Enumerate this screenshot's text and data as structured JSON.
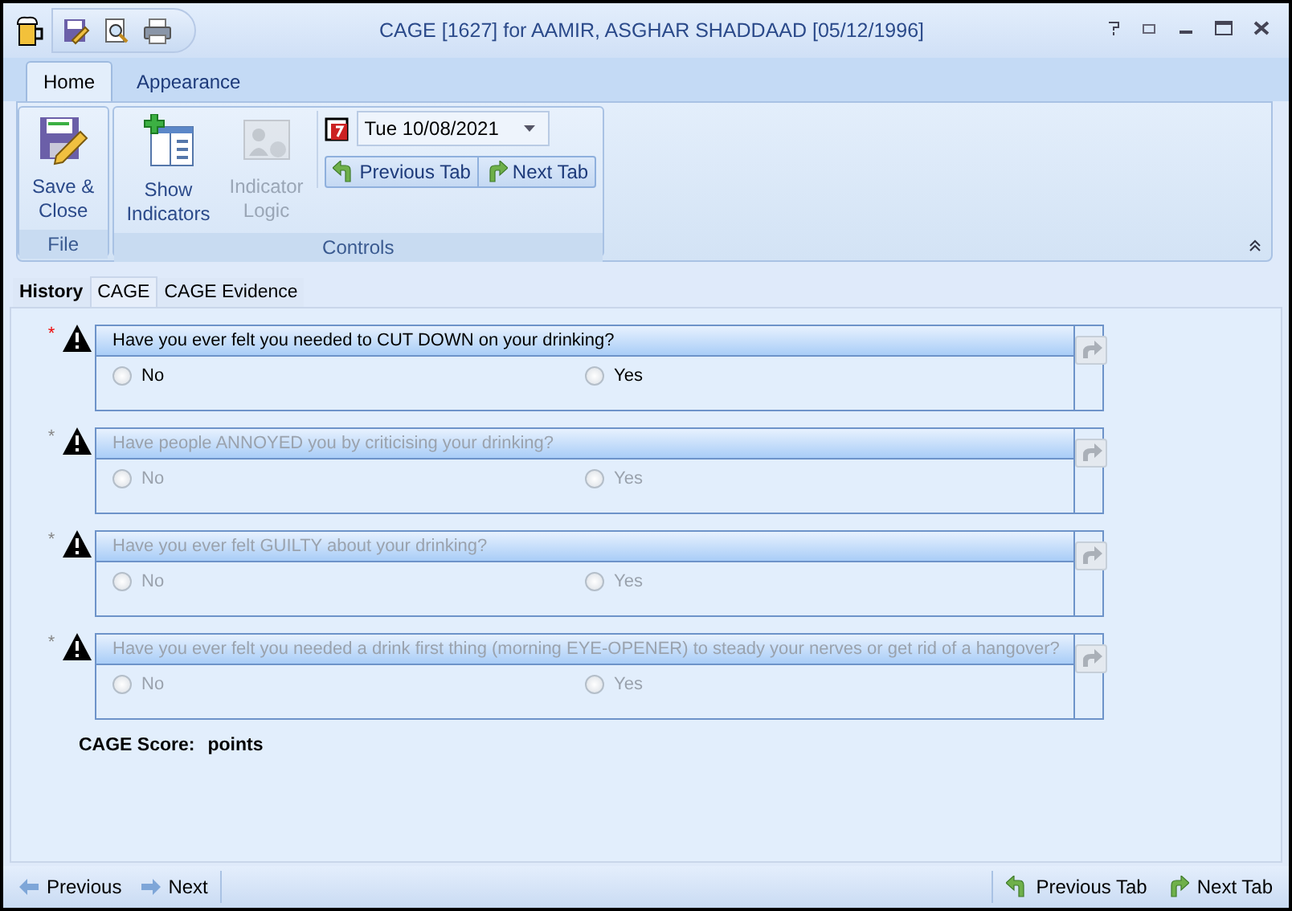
{
  "window": {
    "title": "CAGE [1627] for AAMIR, ASGHAR SHADDAAD [05/12/1996]"
  },
  "ribbon_tabs": [
    {
      "label": "Home",
      "selected": true
    },
    {
      "label": "Appearance",
      "selected": false
    }
  ],
  "ribbon_groups": [
    {
      "label": "File",
      "buttons": [
        {
          "label": "Save &\nClose",
          "kind": "save",
          "disabled": false
        }
      ]
    },
    {
      "label": "Controls",
      "buttons": [
        {
          "label": "Show\nIndicators",
          "kind": "indicators",
          "disabled": false
        },
        {
          "label": "Indicator\nLogic",
          "kind": "logic",
          "disabled": true
        }
      ],
      "date": "Tue 10/08/2021",
      "nav": [
        {
          "label": "Previous Tab",
          "kind": "prev"
        },
        {
          "label": "Next Tab",
          "kind": "next"
        }
      ]
    }
  ],
  "doc_tabs": [
    {
      "label": "History",
      "selected": false
    },
    {
      "label": "CAGE",
      "selected": true
    },
    {
      "label": "CAGE Evidence",
      "selected": false
    }
  ],
  "questions": [
    {
      "required": "*",
      "text": "Have you ever felt you needed to CUT DOWN on your drinking?",
      "disabled": false,
      "options": [
        {
          "label": "No",
          "selected": false
        },
        {
          "label": "Yes",
          "selected": false
        }
      ]
    },
    {
      "required": "*",
      "text": "Have people ANNOYED you by criticising your drinking?",
      "disabled": true,
      "options": [
        {
          "label": "No",
          "selected": false
        },
        {
          "label": "Yes",
          "selected": false
        }
      ]
    },
    {
      "required": "*",
      "text": "Have you ever felt GUILTY about your drinking?",
      "disabled": true,
      "options": [
        {
          "label": "No",
          "selected": false
        },
        {
          "label": "Yes",
          "selected": false
        }
      ]
    },
    {
      "required": "*",
      "text": "Have you ever felt you needed a drink first thing (morning EYE-OPENER) to steady your nerves or get rid of a hangover?",
      "disabled": true,
      "options": [
        {
          "label": "No",
          "selected": false
        },
        {
          "label": "Yes",
          "selected": false
        }
      ]
    }
  ],
  "score": {
    "label": "CAGE Score:",
    "value": "points"
  },
  "footer": {
    "left": [
      {
        "label": "Previous",
        "kind": "back"
      },
      {
        "label": "Next",
        "kind": "forward"
      }
    ],
    "right": [
      {
        "label": "Previous Tab",
        "kind": "prev"
      },
      {
        "label": "Next Tab",
        "kind": "next"
      }
    ]
  }
}
